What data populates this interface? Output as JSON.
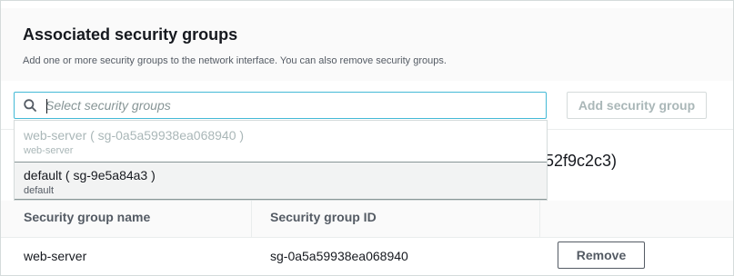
{
  "panel": {
    "title": "Associated security groups",
    "description": "Add one or more security groups to the network interface. You can also remove security groups."
  },
  "search": {
    "value": "",
    "placeholder": "Select security groups",
    "icon": "search-icon"
  },
  "add_button": {
    "label": "Add security group",
    "disabled": true
  },
  "dropdown": {
    "options": [
      {
        "label": "web-server ( sg-0a5a59938ea068940 )",
        "description": "web-server",
        "disabled": true
      },
      {
        "label": "default ( sg-9e5a84a3 )",
        "description": "default",
        "highlighted": true
      }
    ]
  },
  "obscured_text": "52f9c2c3)",
  "table": {
    "columns": [
      "Security group name",
      "Security group ID"
    ],
    "rows": [
      {
        "name": "web-server",
        "id": "sg-0a5a59938ea068940",
        "action": "Remove"
      }
    ]
  },
  "colors": {
    "focus_border": "#44b9d6",
    "text": "#16191f",
    "muted": "#545b64",
    "disabled": "#aab7b8"
  }
}
